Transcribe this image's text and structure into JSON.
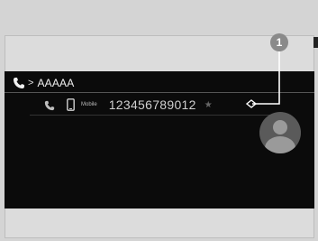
{
  "header": {
    "contact_name": "AAAAA",
    "chevron": ">"
  },
  "contact": {
    "type_label": "Mobile",
    "number": "123456789012",
    "favorite_glyph": "★"
  },
  "callout": {
    "number": "1"
  },
  "icons": {
    "header_phone": "phone-icon",
    "row_call": "call-icon",
    "row_mobile": "mobile-phone-icon",
    "avatar": "person-icon"
  },
  "colors": {
    "screen_bg": "#0b0b0b",
    "callout": "#8a8a8a"
  }
}
